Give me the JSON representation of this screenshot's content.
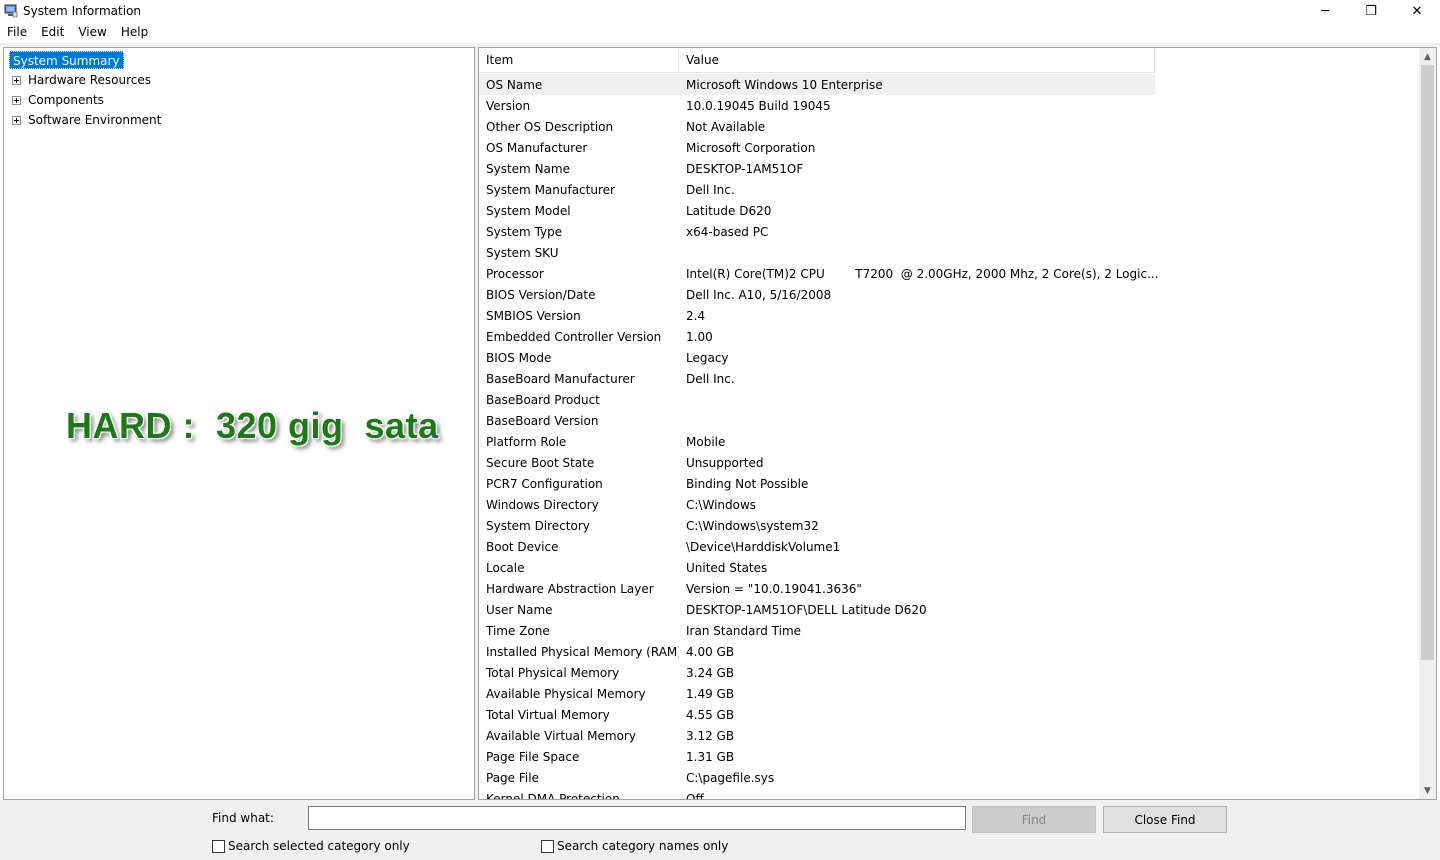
{
  "window": {
    "title": "System Information",
    "minimize_glyph": "─",
    "maximize_glyph": "❐",
    "close_glyph": "✕"
  },
  "menu": [
    "File",
    "Edit",
    "View",
    "Help"
  ],
  "tree": {
    "root": "System Summary",
    "nodes": [
      "Hardware Resources",
      "Components",
      "Software Environment"
    ]
  },
  "overlay_text": "HARD :  320 gig  sata",
  "list": {
    "headers": {
      "item": "Item",
      "value": "Value"
    },
    "rows": [
      {
        "item": "OS Name",
        "value": "Microsoft Windows 10 Enterprise"
      },
      {
        "item": "Version",
        "value": "10.0.19045 Build 19045"
      },
      {
        "item": "Other OS Description",
        "value": "Not Available"
      },
      {
        "item": "OS Manufacturer",
        "value": "Microsoft Corporation"
      },
      {
        "item": "System Name",
        "value": "DESKTOP-1AM51OF"
      },
      {
        "item": "System Manufacturer",
        "value": "Dell Inc."
      },
      {
        "item": "System Model",
        "value": "Latitude D620"
      },
      {
        "item": "System Type",
        "value": "x64-based PC"
      },
      {
        "item": "System SKU",
        "value": ""
      },
      {
        "item": "Processor",
        "value": "Intel(R) Core(TM)2 CPU        T7200  @ 2.00GHz, 2000 Mhz, 2 Core(s), 2 Logic..."
      },
      {
        "item": "BIOS Version/Date",
        "value": "Dell Inc. A10, 5/16/2008"
      },
      {
        "item": "SMBIOS Version",
        "value": "2.4"
      },
      {
        "item": "Embedded Controller Version",
        "value": "1.00"
      },
      {
        "item": "BIOS Mode",
        "value": "Legacy"
      },
      {
        "item": "BaseBoard Manufacturer",
        "value": "Dell Inc."
      },
      {
        "item": "BaseBoard Product",
        "value": ""
      },
      {
        "item": "BaseBoard Version",
        "value": ""
      },
      {
        "item": "Platform Role",
        "value": "Mobile"
      },
      {
        "item": "Secure Boot State",
        "value": "Unsupported"
      },
      {
        "item": "PCR7 Configuration",
        "value": "Binding Not Possible"
      },
      {
        "item": "Windows Directory",
        "value": "C:\\Windows"
      },
      {
        "item": "System Directory",
        "value": "C:\\Windows\\system32"
      },
      {
        "item": "Boot Device",
        "value": "\\Device\\HarddiskVolume1"
      },
      {
        "item": "Locale",
        "value": "United States"
      },
      {
        "item": "Hardware Abstraction Layer",
        "value": "Version = \"10.0.19041.3636\""
      },
      {
        "item": "User Name",
        "value": "DESKTOP-1AM51OF\\DELL Latitude D620"
      },
      {
        "item": "Time Zone",
        "value": "Iran Standard Time"
      },
      {
        "item": "Installed Physical Memory (RAM)",
        "value": "4.00 GB"
      },
      {
        "item": "Total Physical Memory",
        "value": "3.24 GB"
      },
      {
        "item": "Available Physical Memory",
        "value": "1.49 GB"
      },
      {
        "item": "Total Virtual Memory",
        "value": "4.55 GB"
      },
      {
        "item": "Available Virtual Memory",
        "value": "3.12 GB"
      },
      {
        "item": "Page File Space",
        "value": "1.31 GB"
      },
      {
        "item": "Page File",
        "value": "C:\\pagefile.sys"
      },
      {
        "item": "Kernel DMA Protection",
        "value": "Off"
      }
    ]
  },
  "findbar": {
    "label": "Find what:",
    "input_value": "",
    "find_button": "Find",
    "close_button": "Close Find",
    "check_selected_category": "Search selected category only",
    "check_category_names": "Search category names only"
  },
  "colors": {
    "selection": "#0078d7",
    "overlay_text": "#1b7a16"
  }
}
